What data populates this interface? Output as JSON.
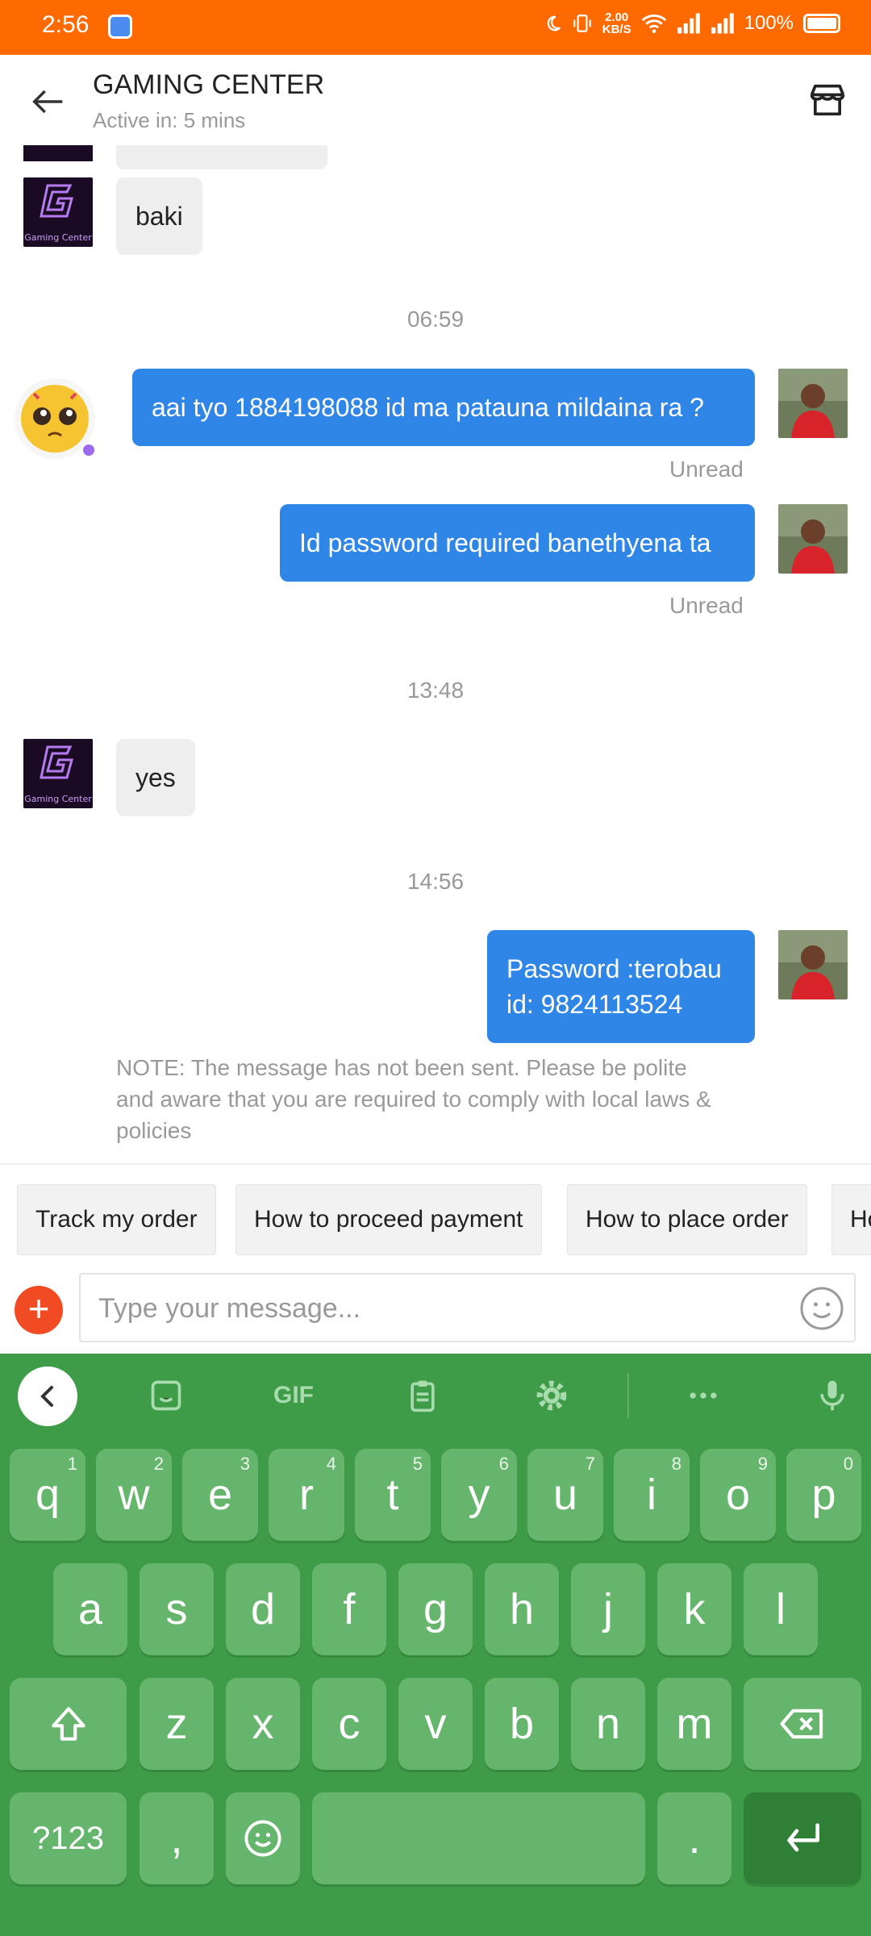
{
  "status_bar": {
    "time": "2:56",
    "net_speed_value": "2.00",
    "net_speed_unit": "KB/S",
    "battery": "100%",
    "icons": [
      "moon-icon",
      "vibrate-icon",
      "wifi-icon",
      "signal-icon",
      "signal-icon",
      "battery-icon"
    ]
  },
  "header": {
    "title": "GAMING CENTER",
    "subtitle": "Active in: 5 mins"
  },
  "chat": {
    "messages": [
      {
        "from": "shop",
        "text": "baki"
      },
      {
        "timestamp": "06:59"
      },
      {
        "from": "me",
        "text": "aai tyo 1884198088 id ma patauna mildaina ra ?",
        "status": "Unread"
      },
      {
        "from": "me",
        "text": "Id password required banethyena ta",
        "status": "Unread"
      },
      {
        "timestamp": "13:48"
      },
      {
        "from": "shop",
        "text": "yes"
      },
      {
        "timestamp": "14:56"
      },
      {
        "from": "me",
        "text_line1": "Password :terobau",
        "text_line2": "id: 9824113524"
      }
    ],
    "note": "NOTE: The message has not been sent. Please be polite and aware that you are required to comply with local laws & policies",
    "shop_avatar_text": "Gaming Center"
  },
  "quick_replies": [
    "Track my order",
    "How to proceed payment",
    "How to place order",
    "Ho"
  ],
  "composer": {
    "placeholder": "Type your message..."
  },
  "keyboard": {
    "toolbar": [
      "chevron-left-icon",
      "sticker-icon",
      "GIF",
      "clipboard-icon",
      "gear-icon",
      "more-icon",
      "mic-icon"
    ],
    "row1": [
      {
        "k": "q",
        "h": "1"
      },
      {
        "k": "w",
        "h": "2"
      },
      {
        "k": "e",
        "h": "3"
      },
      {
        "k": "r",
        "h": "4"
      },
      {
        "k": "t",
        "h": "5"
      },
      {
        "k": "y",
        "h": "6"
      },
      {
        "k": "u",
        "h": "7"
      },
      {
        "k": "i",
        "h": "8"
      },
      {
        "k": "o",
        "h": "9"
      },
      {
        "k": "p",
        "h": "0"
      }
    ],
    "row2": [
      "a",
      "s",
      "d",
      "f",
      "g",
      "h",
      "j",
      "k",
      "l"
    ],
    "row3": [
      "z",
      "x",
      "c",
      "v",
      "b",
      "n",
      "m"
    ],
    "symbols_key": "?123",
    "comma_key": ",",
    "period_key": "."
  },
  "colors": {
    "status_bar": "#ff6a00",
    "outgoing_bubble": "#2f86e6",
    "incoming_bubble": "#eeeeee",
    "keyboard_bg": "#3e9b47",
    "key_bg": "#66b56c",
    "plus_button": "#f04b22"
  }
}
